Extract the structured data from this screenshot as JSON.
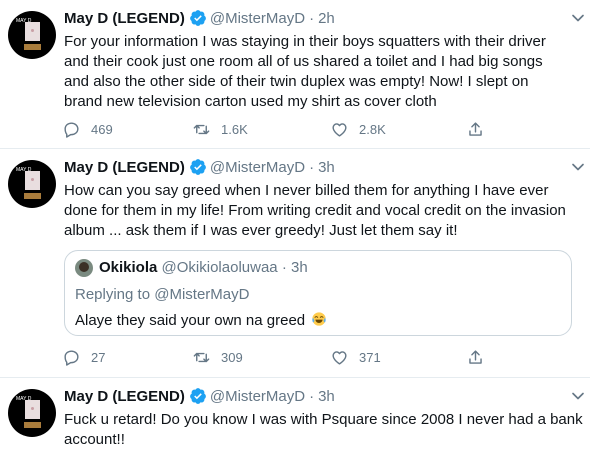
{
  "tweets": [
    {
      "name": "May D (LEGEND)",
      "handle": "@MisterMayD",
      "dot": "·",
      "time": "2h",
      "avatar_label": "MAY D",
      "lines": [
        "For your information I was staying in their boys squatters with their driver",
        "and their cook just one room all of us shared a toilet and I had big songs",
        "and also the other side of their twin duplex was empty! Now! I slept on",
        "brand new television carton used my shirt as cover cloth"
      ],
      "replies": "469",
      "retweets": "1.6K",
      "likes": "2.8K"
    },
    {
      "name": "May D (LEGEND)",
      "handle": "@MisterMayD",
      "dot": "·",
      "time": "3h",
      "avatar_label": "MAY D",
      "lines": [
        "How can you say greed when I never billed them for anything I have ever",
        "done for them in my life! From writing credit and vocal credit on the invasion",
        "album ... ask them if I was ever greedy! Just let them say it!"
      ],
      "quote": {
        "name": "Okikiola",
        "handle": "@Okikiolaoluwaa",
        "dot": "·",
        "time": "3h",
        "replying_prefix": "Replying to",
        "replying_to": "@MisterMayD",
        "text": "Alaye they said your own na greed",
        "emoji": "face-with-tears-of-joy"
      },
      "replies": "27",
      "retweets": "309",
      "likes": "371"
    },
    {
      "name": "May D (LEGEND)",
      "handle": "@MisterMayD",
      "dot": "·",
      "time": "3h",
      "avatar_label": "MAY D",
      "lines": [
        "Fuck u retard! Do you know I was with Psquare since 2008 I never had a bank",
        "account!!"
      ]
    }
  ],
  "colors": {
    "text": "#0f1419",
    "muted": "#657786",
    "verified": "#1da1f2",
    "border": "#e6ecf0"
  }
}
